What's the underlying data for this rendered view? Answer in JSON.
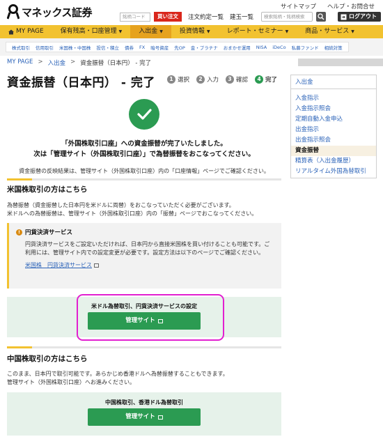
{
  "header": {
    "logo_text": "マネックス証券",
    "top_links": [
      "サイトマップ",
      "ヘルプ・お問合せ"
    ],
    "stock_code_placeholder": "銘柄コード",
    "buy_order": "買い注文",
    "links": [
      "注文約定一覧",
      "建玉一覧"
    ],
    "search_placeholder": "検索銘柄・銘柄検索",
    "logout": "ログアウト"
  },
  "main_nav": [
    {
      "label": "MY PAGE",
      "caret": false,
      "active": false
    },
    {
      "label": "保有残高・口座管理",
      "caret": true,
      "active": false
    },
    {
      "label": "入出金",
      "caret": true,
      "active": true
    },
    {
      "label": "投資情報",
      "caret": true,
      "active": false
    },
    {
      "label": "レポート・セミナー",
      "caret": true,
      "active": false
    },
    {
      "label": "商品・サービス",
      "caret": true,
      "active": false
    }
  ],
  "sub_nav": [
    "株式取引",
    "信用取引",
    "米国株・中国株",
    "投信・積立",
    "債券",
    "FX",
    "暗号資産",
    "先OP",
    "金・プラチナ",
    "おまかせ運用",
    "NISA",
    "iDeCo",
    "私募ファンド",
    "相続対策"
  ],
  "breadcrumb": {
    "items": [
      "MY PAGE",
      "入出金",
      "資金振替（日本円） - 完了"
    ],
    "sep": ">"
  },
  "page_title": "資金振替（日本円） - 完了",
  "steps": [
    {
      "num": "1",
      "label": "選択"
    },
    {
      "num": "2",
      "label": "入力"
    },
    {
      "num": "3",
      "label": "確認"
    },
    {
      "num": "4",
      "label": "完了"
    }
  ],
  "sidebar": {
    "title": "入出金",
    "items": [
      {
        "label": "入金指示"
      },
      {
        "label": "入金指示照会"
      },
      {
        "label": "定期自動入金申込"
      },
      {
        "label": "出金指示"
      },
      {
        "label": "出金指示照会"
      },
      {
        "label": "資金振替"
      },
      {
        "label": "精算表（入出金履歴）"
      },
      {
        "label": "リアルタイム外国為替取引"
      }
    ],
    "selected_index": 5
  },
  "complete": {
    "line1": "「外国株取引口座」への資金振替が完了いたしました。",
    "line2": "次は「管理サイト（外国株取引口座）」で為替振替をおこなってください。",
    "note": "資金振替の反映結果は、管理サイト（外国株取引口座）内の「口座情報」ページでご確認ください。"
  },
  "us": {
    "heading": "米国株取引の方はこちら",
    "p1": "為替振替（資金振替した日本円を米ドルに両替）をおこなっていただく必要がございます。",
    "p2": "米ドルへの為替振替は、管理サイト（外国株取引口座）内の「振替」ページでおこなってください。",
    "yen": {
      "title": "円貨決済サービス",
      "body": "円貨決済サービスをご設定いただければ、日本円から直接米国株を買い付けることも可能です。ご利用には、管理サイト内での設定変更が必要です。設定方法は以下のページでご確認ください。",
      "link": "米国株　円貨決済サービス"
    },
    "box_title": "米ドル為替取引、円貨決済サービスの設定",
    "button": "管理サイト"
  },
  "cn": {
    "heading": "中国株取引の方はこちら",
    "p1": "このまま、日本円で取引可能です。あらかじめ香港ドルへ為替振替することもできます。",
    "p2": "管理サイト（外国株取引口座）へお進みください。",
    "box_title": "中国株取引、香港ドル為替取引",
    "button": "管理サイト"
  },
  "colors": {
    "accent": "#f2c230",
    "nav_active": "#e6a21e",
    "green": "#2b9b52",
    "link": "#2a62b8",
    "highlight": "#e21fd0",
    "buy": "#d9261c"
  }
}
